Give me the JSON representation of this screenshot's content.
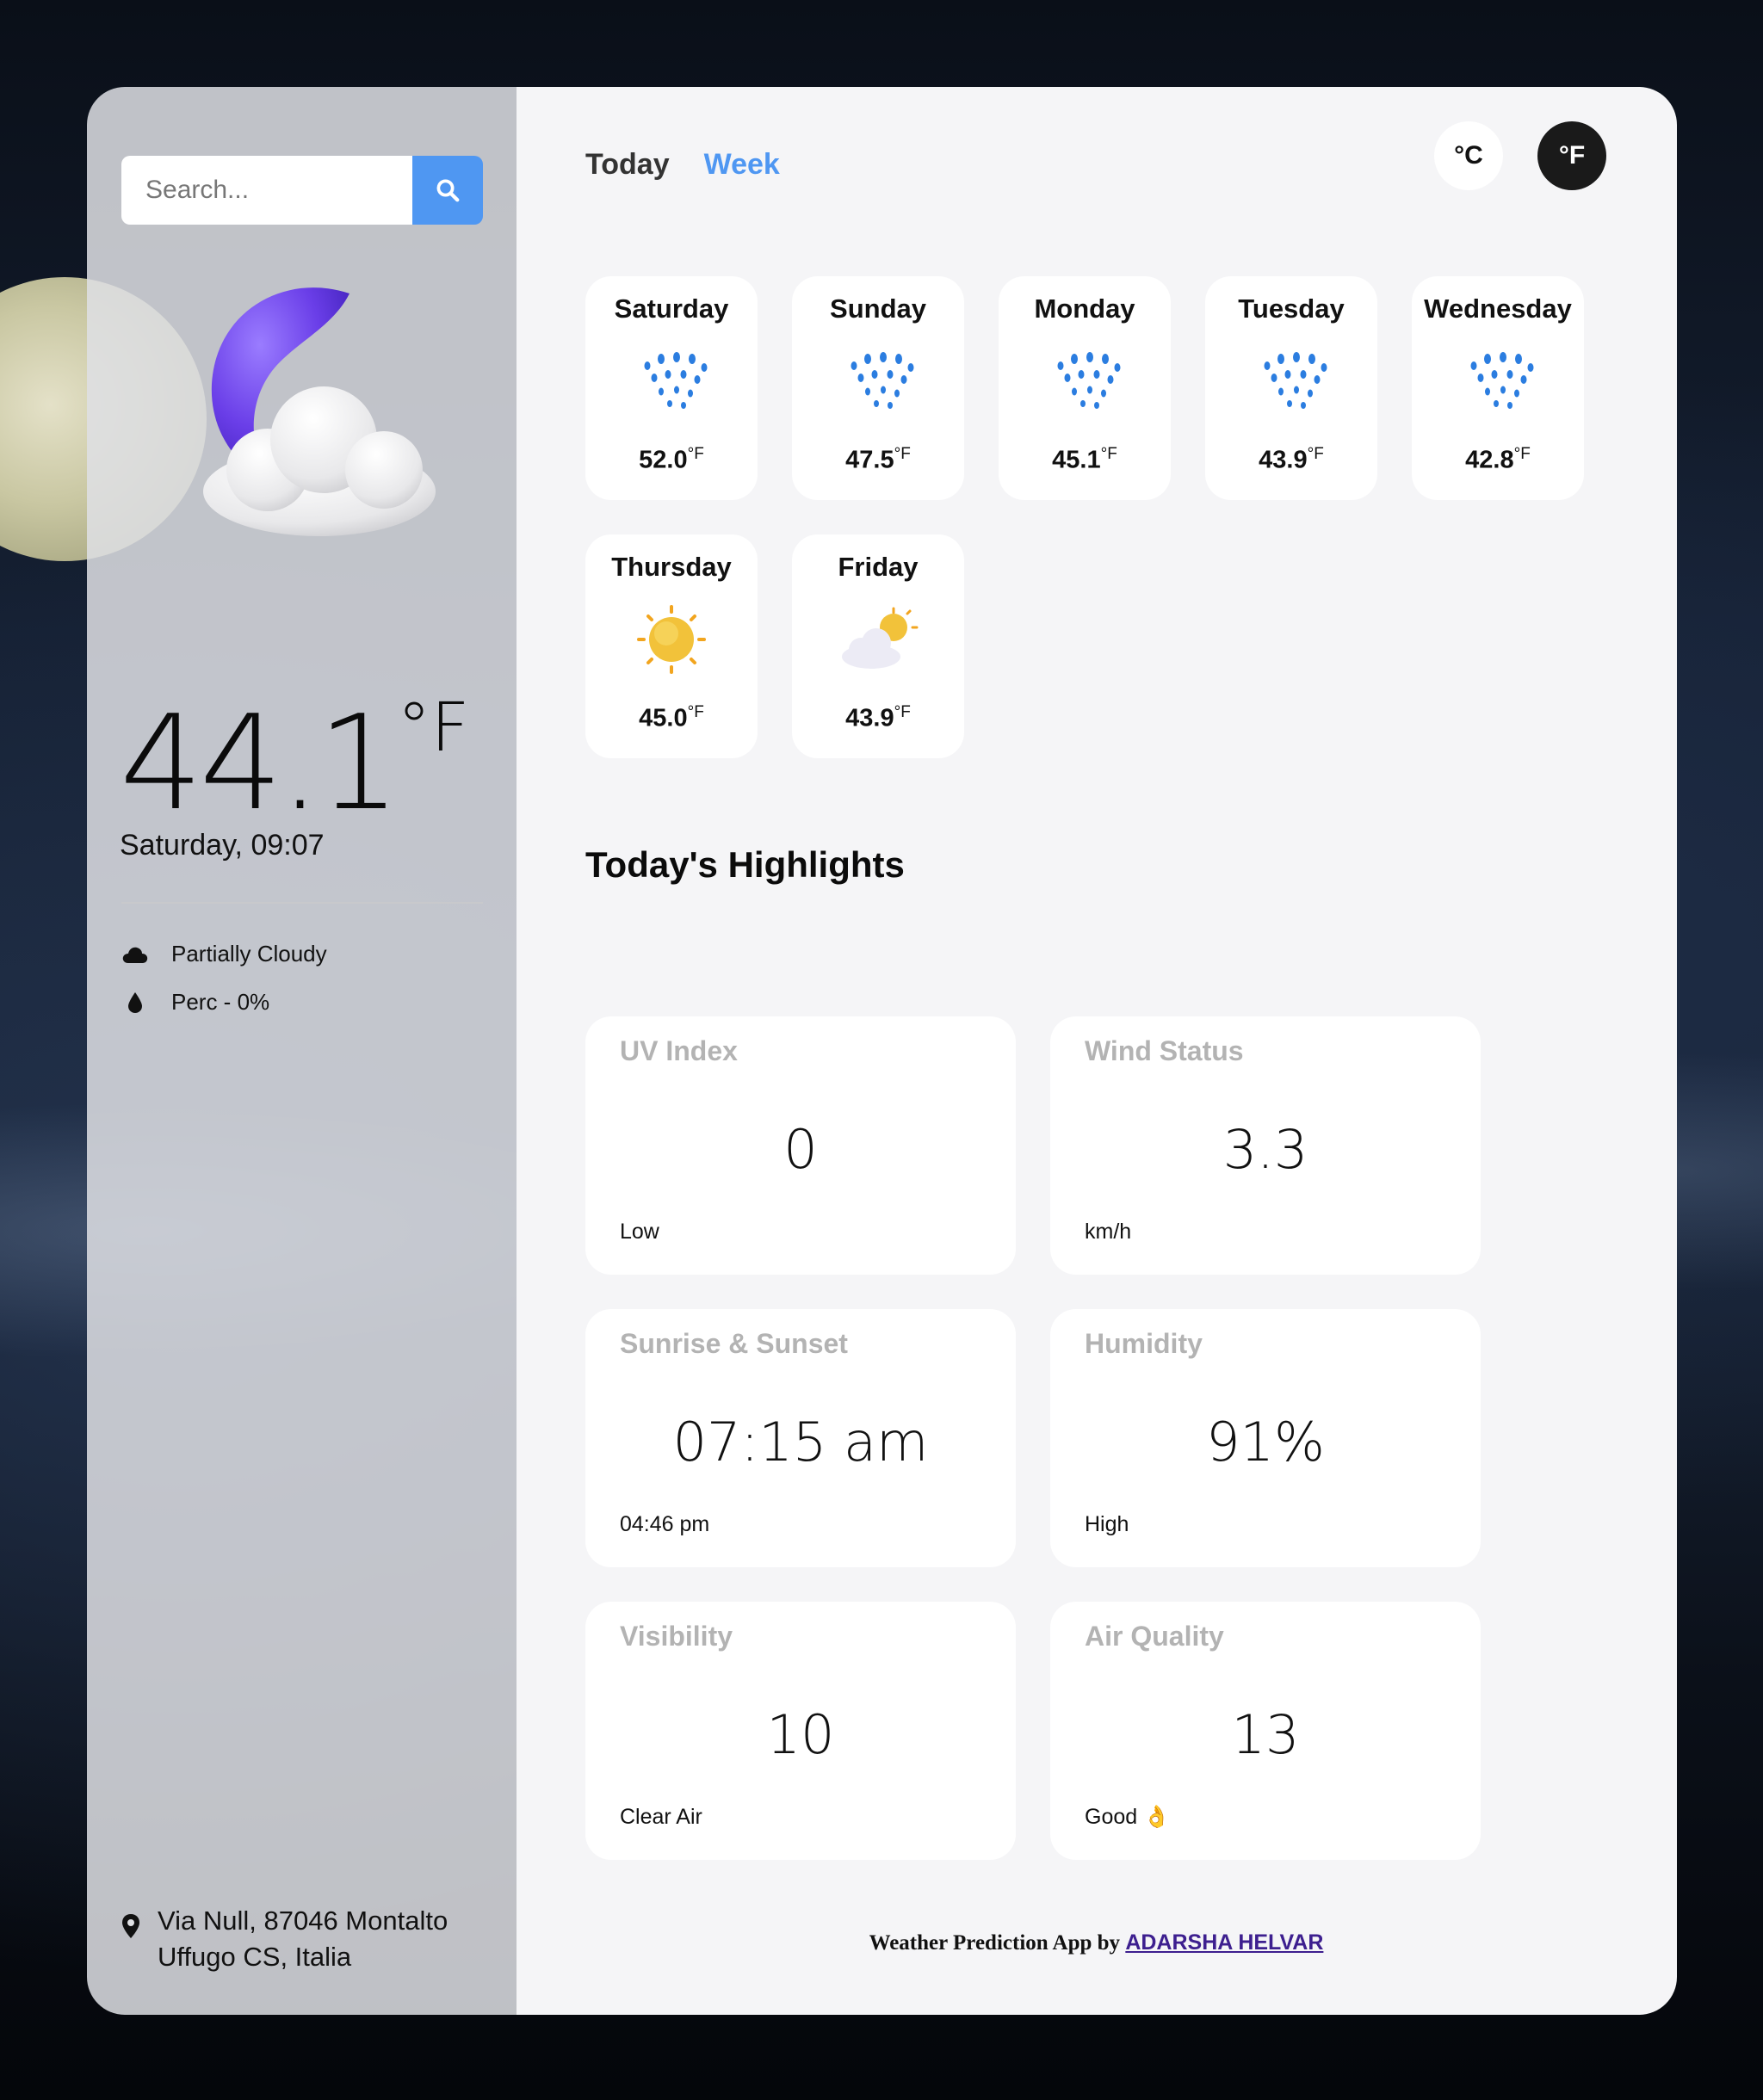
{
  "search": {
    "placeholder": "Search..."
  },
  "current": {
    "temperature": "44.1",
    "unit": "°F",
    "datetime": "Saturday, 09:07",
    "condition": "Partially Cloudy",
    "precipitation": "Perc - 0%",
    "location_line1": "Via Null, 87046 Montalto",
    "location_line2": "Uffugo CS, Italia"
  },
  "tabs": [
    {
      "label": "Today",
      "active": false
    },
    {
      "label": "Week",
      "active": true
    }
  ],
  "units": [
    {
      "label": "°C",
      "active": false
    },
    {
      "label": "°F",
      "active": true
    }
  ],
  "week": [
    {
      "day": "Saturday",
      "temp": "52.0",
      "unit": "°F",
      "icon": "rain-icon"
    },
    {
      "day": "Sunday",
      "temp": "47.5",
      "unit": "°F",
      "icon": "rain-icon"
    },
    {
      "day": "Monday",
      "temp": "45.1",
      "unit": "°F",
      "icon": "rain-icon"
    },
    {
      "day": "Tuesday",
      "temp": "43.9",
      "unit": "°F",
      "icon": "rain-icon"
    },
    {
      "day": "Wednesday",
      "temp": "42.8",
      "unit": "°F",
      "icon": "rain-icon"
    },
    {
      "day": "Thursday",
      "temp": "45.0",
      "unit": "°F",
      "icon": "sun-icon"
    },
    {
      "day": "Friday",
      "temp": "43.9",
      "unit": "°F",
      "icon": "partly-cloudy-icon"
    }
  ],
  "highlights_title": "Today's Highlights",
  "highlights": [
    {
      "title": "UV Index",
      "value": "0",
      "status": "Low"
    },
    {
      "title": "Wind Status",
      "value": "3.3",
      "status": "km/h"
    },
    {
      "title": "Sunrise & Sunset",
      "value": "07:15 am",
      "status": "04:46 pm"
    },
    {
      "title": "Humidity",
      "value": "91%",
      "status": "High"
    },
    {
      "title": "Visibility",
      "value": "10",
      "status": "Clear Air"
    },
    {
      "title": "Air Quality",
      "value": "13",
      "status": "Good 👌"
    }
  ],
  "footer": {
    "text": "Weather Prediction App by ",
    "link": "ADARSHA HELVAR"
  },
  "colors": {
    "accent": "#4f97f2",
    "active_unit_bg": "#1a1a1a",
    "link": "#3d1f8f"
  }
}
